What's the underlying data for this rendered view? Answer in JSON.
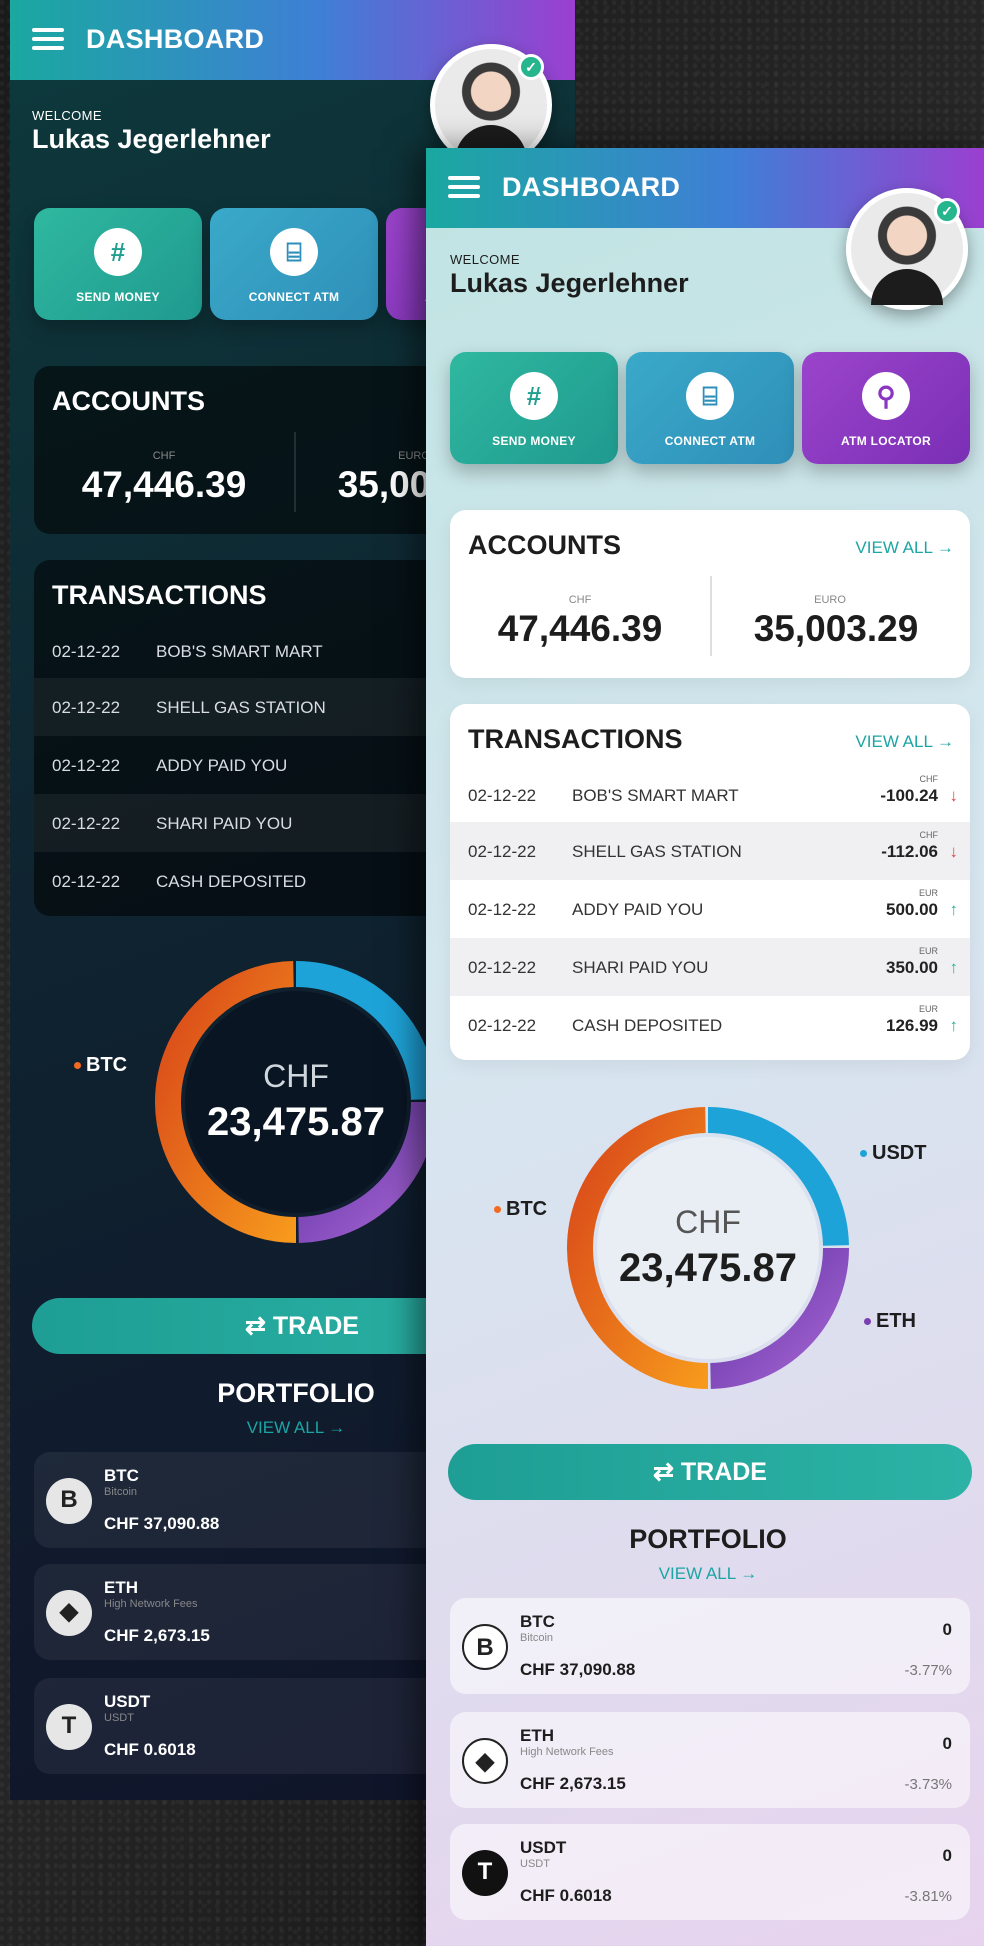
{
  "app": {
    "header_title": "DASHBOARD",
    "welcome_label": "WELCOME",
    "user_name": "Lukas Jegerlehner"
  },
  "actions": [
    {
      "label": "SEND MONEY",
      "icon": "hash-icon"
    },
    {
      "label": "CONNECT ATM",
      "icon": "scan-icon"
    },
    {
      "label": "ATM LOCATOR",
      "icon": "location-pin-icon"
    }
  ],
  "accounts": {
    "title": "ACCOUNTS",
    "view_all": "VIEW ALL →",
    "items": [
      {
        "currency": "CHF",
        "value": "47,446.39"
      },
      {
        "currency": "EURO",
        "value": "35,003.29"
      }
    ]
  },
  "transactions": {
    "title": "TRANSACTIONS",
    "view_all": "VIEW ALL →",
    "rows": [
      {
        "date": "02-12-22",
        "desc": "BOB'S SMART MART",
        "currency": "CHF",
        "amount": "-100.24",
        "arrow": "↓"
      },
      {
        "date": "02-12-22",
        "desc": "SHELL GAS STATION",
        "currency": "CHF",
        "amount": "-112.06",
        "arrow": "↓"
      },
      {
        "date": "02-12-22",
        "desc": "ADDY PAID YOU",
        "currency": "EUR",
        "amount": "500.00",
        "arrow": "↑"
      },
      {
        "date": "02-12-22",
        "desc": "SHARI PAID YOU",
        "currency": "EUR",
        "amount": "350.00",
        "arrow": "↑"
      },
      {
        "date": "02-12-22",
        "desc": "CASH DEPOSITED",
        "currency": "EUR",
        "amount": "126.99",
        "arrow": "↑"
      }
    ]
  },
  "holdings": {
    "currency": "CHF",
    "total": "23,475.87",
    "legend": [
      {
        "label": "BTC",
        "color": "#f26a1f"
      },
      {
        "label": "USDT",
        "color": "#1ea3d8"
      },
      {
        "label": "ETH",
        "color": "#7a3fb0"
      }
    ],
    "segments": [
      {
        "label": "USDT",
        "fraction": 0.25,
        "colors": [
          "#1ea3d8",
          "#1ea3d8"
        ]
      },
      {
        "label": "ETH",
        "fraction": 0.25,
        "colors": [
          "#5a2fa0",
          "#a765d3"
        ]
      },
      {
        "label": "BTC",
        "fraction": 0.5,
        "colors": [
          "#d8461a",
          "#f79a1c"
        ]
      }
    ]
  },
  "trade_button": "⇄ TRADE",
  "portfolio": {
    "title": "PORTFOLIO",
    "view_all": "VIEW ALL →",
    "coins": [
      {
        "symbol": "BTC",
        "name": "Bitcoin",
        "value": "CHF 37,090.88",
        "qty": "0",
        "change": "-3.77%",
        "icon_char": "B"
      },
      {
        "symbol": "ETH",
        "name": "High Network Fees",
        "value": "CHF 2,673.15",
        "qty": "0",
        "change": "-3.73%",
        "icon_char": "◆"
      },
      {
        "symbol": "USDT",
        "name": "USDT",
        "value": "CHF 0.6018",
        "qty": "0",
        "change": "-3.81%",
        "icon_char": "T"
      }
    ]
  },
  "colors": {
    "accent": "#1ba5a4",
    "header_gradient": [
      "#1aa8a0",
      "#3f7fd6",
      "#9b3fd0"
    ],
    "negative": "#e24747",
    "positive": "#24b59a"
  }
}
